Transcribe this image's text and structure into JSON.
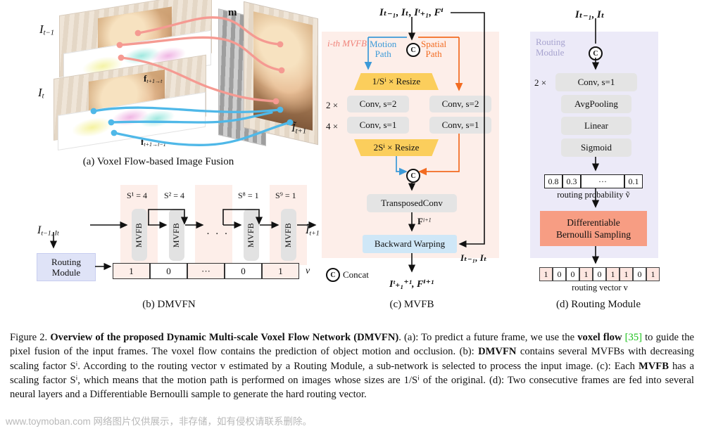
{
  "figure": {
    "number": "Figure 2.",
    "title": "Overview of the proposed Dynamic Multi-scale Voxel Flow Network (DMVFN)",
    "caption_a": "(a): To predict a future frame, we use the ",
    "voxel_flow_bold": "voxel flow",
    "citation": "[35]",
    "caption_a2": " to guide the pixel fusion of the input frames. The voxel flow contains the prediction of object motion and occlusion.",
    "caption_b_prefix": "(b): ",
    "caption_b_bold": "DMVFN",
    "caption_b": " contains several MVFBs with decreasing scaling factor Sⁱ. According to the routing vector v estimated by a Routing Module, a sub-network is selected to process the input image. ",
    "caption_c_prefix": "(c): Each ",
    "caption_c_bold": "MVFB",
    "caption_c": " has a scaling factor Sⁱ, which means that the motion path is performed on images whose sizes are 1/Sⁱ of the original. ",
    "caption_d": "(d): Two consecutive frames are fed into several neural layers and a Differentiable Bernoulli sample to generate the hard routing vector."
  },
  "watermark": "www.toymoban.com 网络图片仅供展示，非存储，如有侵权请联系删除。",
  "subcaptions": {
    "a": "(a) Voxel Flow-based Image Fusion",
    "b": "(b) DMVFN",
    "c": "(c) MVFB",
    "d": "(d) Routing Module"
  },
  "panel_a": {
    "label_prev_frame": "I",
    "label_prev_frame_sub": "t−1",
    "label_cur_frame": "I",
    "label_cur_frame_sub": "t",
    "label_mask": "m",
    "label_output": "Ĩ",
    "label_output_sub": "t+1",
    "flow_fwd": "f",
    "flow_fwd_sub": "t+1→t",
    "flow_bwd": "f",
    "flow_bwd_sub": "t+1→t−1",
    "colors": {
      "pink_flow": "#f59a92",
      "blue_flow": "#4fb8e8"
    }
  },
  "panel_b": {
    "input_label": "I",
    "input_label_sub": "t−1, I",
    "input_label_sub2": "t",
    "output_label": "Ĩ",
    "output_label_sub": "t+1",
    "routing_module_line1": "Routing",
    "routing_module_line2": "Module",
    "block_label": "MVFB",
    "scale_labels": [
      "S¹ = 4",
      "S² = 4",
      "",
      "S⁸ = 1",
      "S⁹ = 1"
    ],
    "routing_vector_cells": [
      "1",
      "0",
      "···",
      "0",
      "1"
    ],
    "routing_vector_name": "v",
    "ellipsis": "· · ·",
    "colors": {
      "panel_pink": "#fdeee9",
      "routing_blue": "#dfe3f7",
      "block_gray": "#e2e2e2"
    }
  },
  "panel_c": {
    "input_label": "Iₜ₋₁, Iₜ, Iᵗ₊₁, Fⁱ",
    "block_title": "i-th MVFB",
    "motion_path_line1": "Motion",
    "motion_path_line2": "Path",
    "spatial_path_line1": "Spatial",
    "spatial_path_line2": "Path",
    "resize_down": "1/Sⁱ × Resize",
    "resize_up": "2Sⁱ × Resize",
    "conv_s2": "Conv, s=2",
    "conv_s1": "Conv, s=1",
    "mult_2x": "2 ×",
    "mult_4x": "4 ×",
    "transposed_conv": "TransposedConv",
    "flow_out": "F",
    "flow_out_sup": "i+1",
    "backward_warping": "Backward Warping",
    "warp_input": "Iₜ₋₁, Iₜ",
    "output_label": "Iᵗ₊₁⁺¹, Fⁱ⁺¹",
    "concat_legend": "Concat",
    "concat_symbol": "C",
    "colors": {
      "panel_pink": "#fdeee9",
      "resize_yellow": "#fbce5c",
      "conv_gray": "#e4e4e4",
      "warp_blue": "#cfe7f7",
      "motion_blue": "#3c9ad8",
      "spatial_orange": "#f26b21",
      "title_pink": "#f0837a"
    }
  },
  "panel_d": {
    "input_label": "Iₜ₋₁, Iₜ",
    "module_line1": "Routing",
    "module_line2": "Module",
    "mult_2x": "2 ×",
    "conv_s1": "Conv, s=1",
    "avgpooling": "AvgPooling",
    "linear": "Linear",
    "sigmoid": "Sigmoid",
    "probability_cells": [
      "0.8",
      "0.3",
      "···",
      "0.1"
    ],
    "probability_caption": "routing probability ṽ",
    "sampling_line1": "Differentiable",
    "sampling_line2": "Bernoulli Sampling",
    "routing_vector": [
      "1",
      "0",
      "0",
      "1",
      "0",
      "1",
      "1",
      "0",
      "1"
    ],
    "routing_vector_caption": "routing vector v",
    "concat_symbol": "C",
    "colors": {
      "panel_lavender": "#eceaf8",
      "block_gray": "#e4e4e4",
      "sampling_salmon": "#f79d83",
      "module_label": "#a7a3cf",
      "cell_pink": "#fde6e0"
    }
  }
}
